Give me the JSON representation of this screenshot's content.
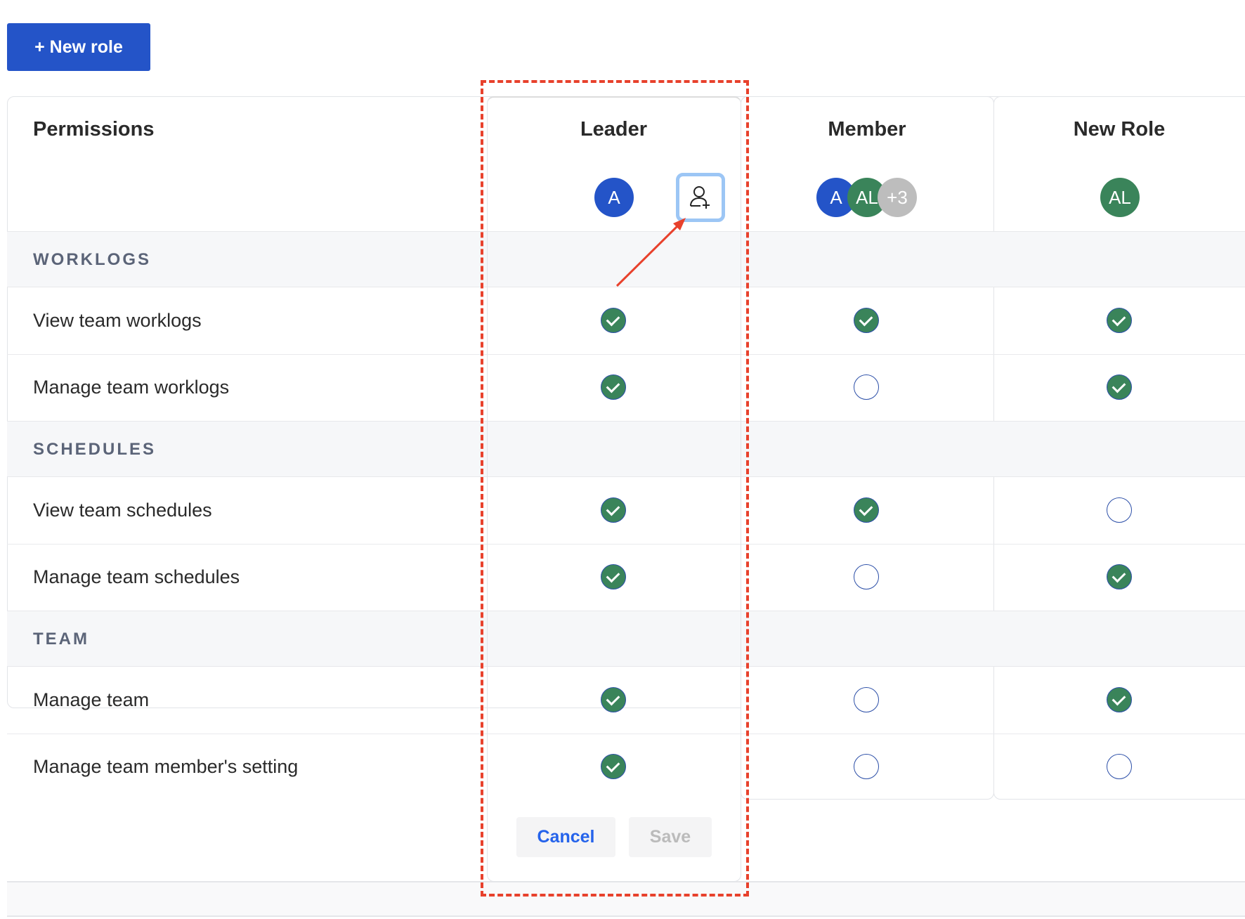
{
  "toolbar": {
    "new_role_label": "+ New role"
  },
  "table": {
    "permissions_header": "Permissions",
    "roles": [
      {
        "name": "Leader",
        "avatars": [
          "A"
        ]
      },
      {
        "name": "Member",
        "avatars": [
          "A",
          "AL",
          "+3"
        ]
      },
      {
        "name": "New Role",
        "avatars": [
          "AL"
        ]
      }
    ],
    "sections": [
      {
        "title": "WORKLOGS",
        "rows": [
          {
            "label": "View team worklogs",
            "values": [
              true,
              true,
              true
            ]
          },
          {
            "label": "Manage team worklogs",
            "values": [
              true,
              false,
              true
            ]
          }
        ]
      },
      {
        "title": "SCHEDULES",
        "rows": [
          {
            "label": "View team schedules",
            "values": [
              true,
              true,
              false
            ]
          },
          {
            "label": "Manage team schedules",
            "values": [
              true,
              false,
              true
            ]
          }
        ]
      },
      {
        "title": "TEAM",
        "rows": [
          {
            "label": "Manage team",
            "values": [
              true,
              false,
              true
            ]
          },
          {
            "label": "Manage team member's setting",
            "values": [
              true,
              false,
              false
            ]
          }
        ]
      }
    ]
  },
  "editor": {
    "cancel_label": "Cancel",
    "save_label": "Save"
  },
  "colors": {
    "primary": "#2454c8",
    "check": "#3a845a",
    "annotation": "#e8412c",
    "avatar_green": "#3a845a",
    "avatar_gray": "#bdbdbd"
  },
  "icons": {
    "add_user": "add-user-icon",
    "check": "check-icon"
  }
}
